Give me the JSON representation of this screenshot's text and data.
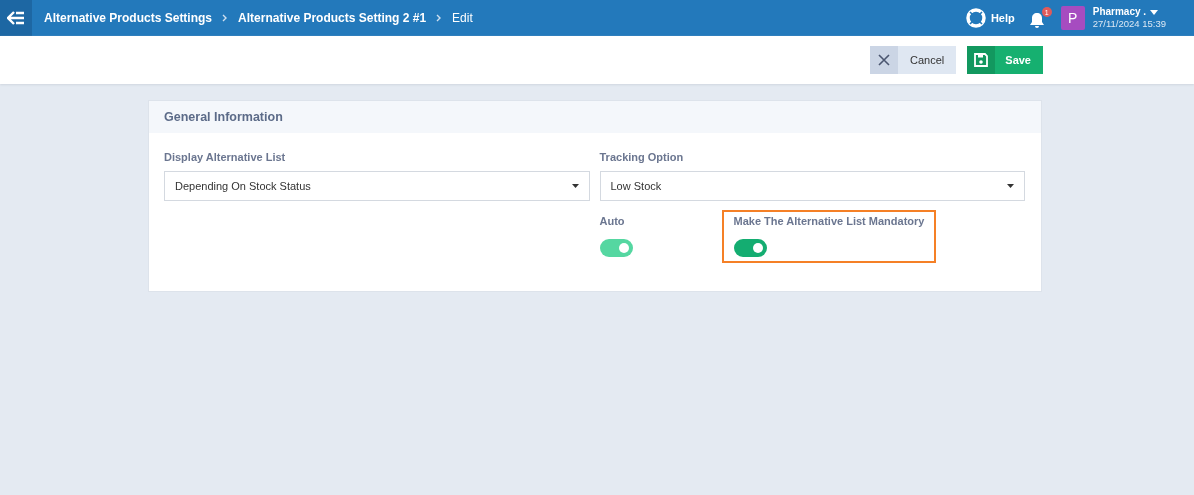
{
  "breadcrumbs": [
    "Alternative Products Settings",
    "Alternative Products Setting 2 #1",
    "Edit"
  ],
  "header": {
    "help": "Help",
    "notification_count": "1",
    "user_initial": "P",
    "user_name": "Pharmacy .",
    "datetime": "27/11/2024 15:39"
  },
  "actions": {
    "cancel": "Cancel",
    "save": "Save"
  },
  "card": {
    "title": "General Information",
    "fields": [
      {
        "label": "Display Alternative List",
        "value": "Depending On Stock Status"
      },
      {
        "label": "Tracking Option",
        "value": "Low Stock"
      }
    ],
    "toggles": [
      {
        "label": "Auto",
        "on": true,
        "disabled": true,
        "highlighted": false
      },
      {
        "label": "Make The Alternative List Mandatory",
        "on": true,
        "disabled": false,
        "highlighted": true
      }
    ]
  }
}
